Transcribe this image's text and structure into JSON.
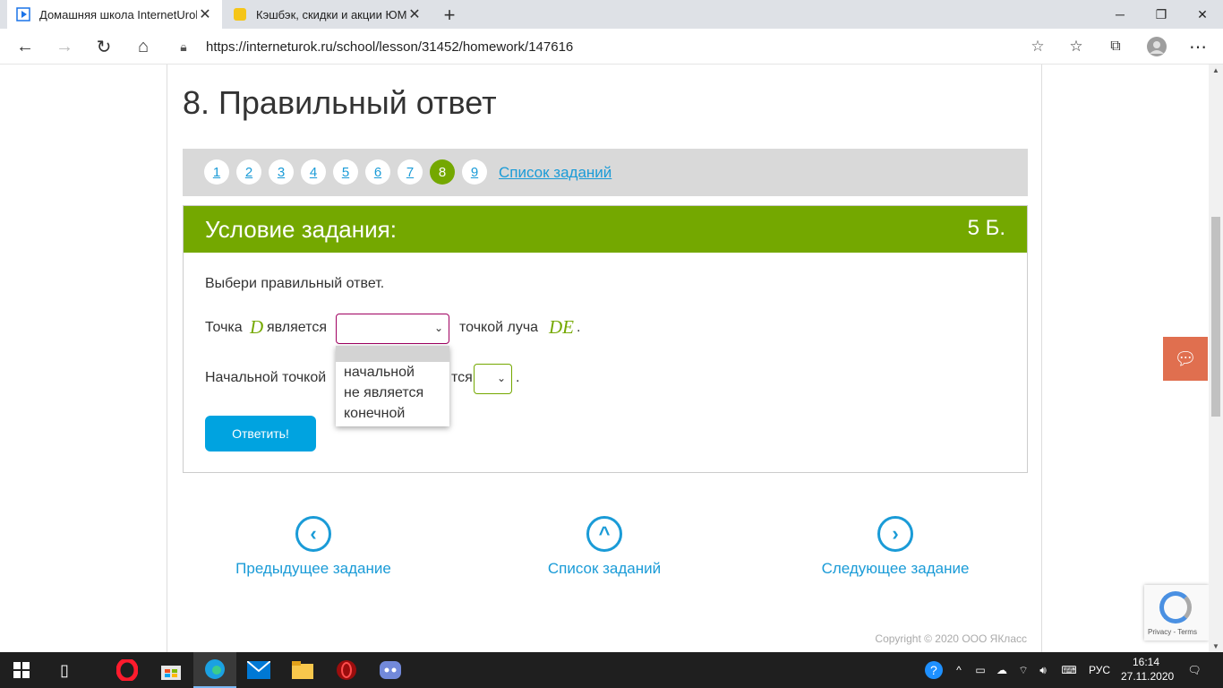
{
  "browser": {
    "tabs": [
      {
        "title": "Домашняя школа InternetUrok.r",
        "active": true
      },
      {
        "title": "Кэшбэк, скидки и акции ЮМоn",
        "active": false
      }
    ],
    "url": "https://interneturok.ru/school/lesson/31452/homework/147616"
  },
  "page": {
    "title": "8. Правильный ответ",
    "task_numbers": [
      "1",
      "2",
      "3",
      "4",
      "5",
      "6",
      "7",
      "8",
      "9"
    ],
    "current_task": "8",
    "task_list_link": "Список заданий",
    "task_header": "Условие задания:",
    "points": "5 Б.",
    "instruction": "Выбери правильный ответ.",
    "q1": {
      "prefix": "Точка",
      "var1": "D",
      "mid": "является",
      "suffix": "точкой луча",
      "var2": "DE",
      "end": "."
    },
    "dropdown_options": [
      "",
      "начальной",
      "не является",
      "конечной"
    ],
    "q2": {
      "prefix": "Начальной точкой",
      "mid": "тся",
      "end": "."
    },
    "answer_button": "Ответить!",
    "nav": {
      "prev": "Предыдущее задание",
      "list": "Список заданий",
      "next": "Следующее задание"
    },
    "copyright": "Copyright © 2020 ООО ЯКласс",
    "recaptcha_links": "Privacy - Terms"
  },
  "taskbar": {
    "language": "РУС",
    "time": "16:14",
    "date": "27.11.2020"
  }
}
